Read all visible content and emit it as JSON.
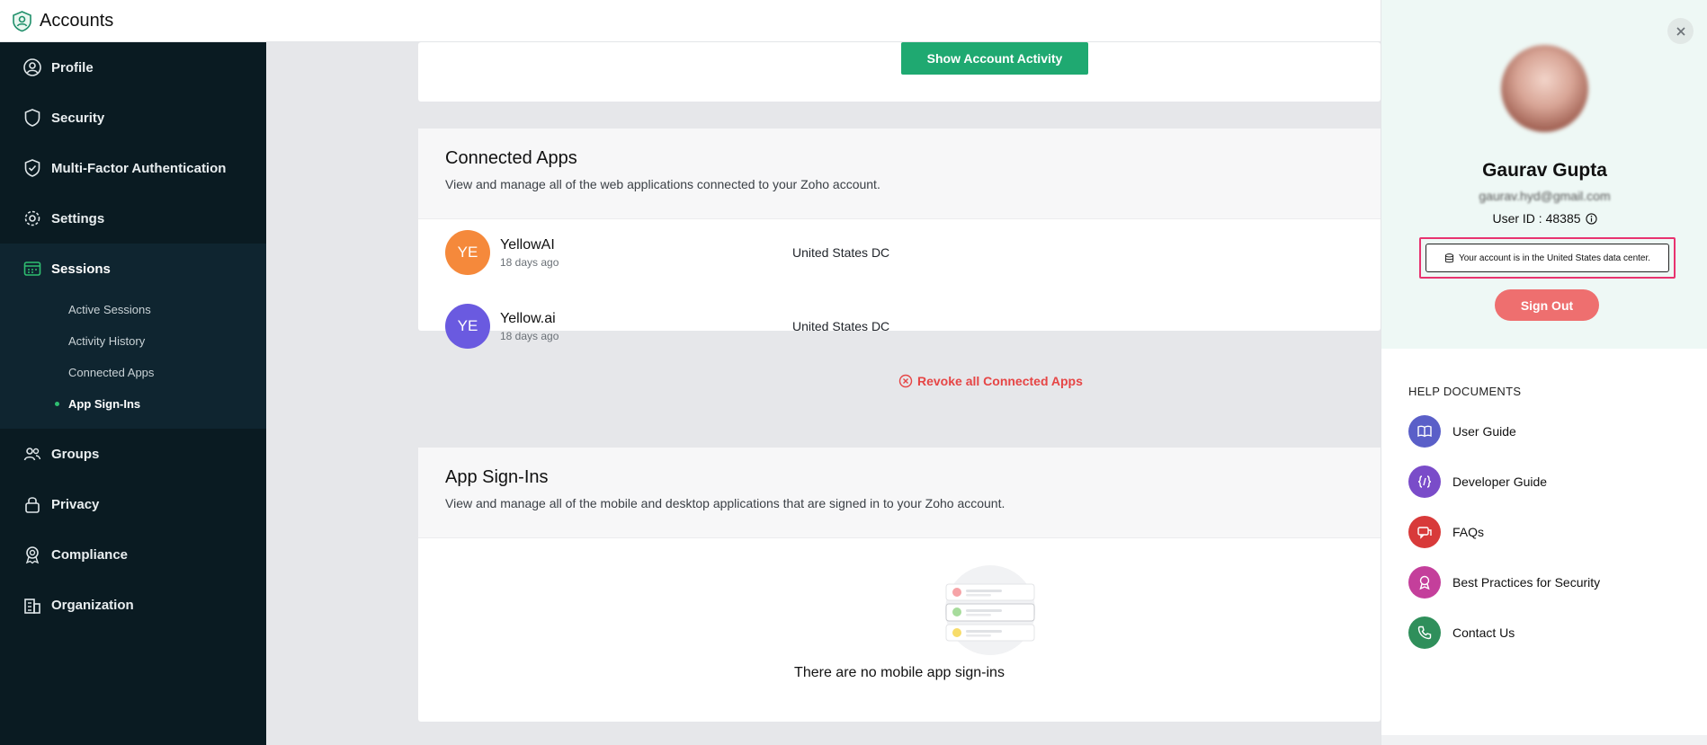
{
  "header": {
    "title": "Accounts"
  },
  "sidebar": {
    "items": [
      {
        "label": "Profile",
        "icon": "user-circle-icon"
      },
      {
        "label": "Security",
        "icon": "shield-icon"
      },
      {
        "label": "Multi-Factor Authentication",
        "icon": "shield-check-icon"
      },
      {
        "label": "Settings",
        "icon": "gear-icon"
      },
      {
        "label": "Sessions",
        "icon": "sessions-icon",
        "active": true
      },
      {
        "label": "Groups",
        "icon": "users-icon"
      },
      {
        "label": "Privacy",
        "icon": "lock-icon"
      },
      {
        "label": "Compliance",
        "icon": "badge-icon"
      },
      {
        "label": "Organization",
        "icon": "building-icon"
      }
    ],
    "sessions_sub": [
      {
        "label": "Active Sessions"
      },
      {
        "label": "Activity History"
      },
      {
        "label": "Connected Apps"
      },
      {
        "label": "App Sign-Ins",
        "current": true
      }
    ]
  },
  "main": {
    "show_activity_label": "Show Account Activity",
    "connected_apps": {
      "title": "Connected Apps",
      "description": "View and manage all of the web applications connected to your Zoho account.",
      "apps": [
        {
          "initials": "YE",
          "name": "YellowAI",
          "time": "18 days ago",
          "dc": "United States DC",
          "color": "#f5893b"
        },
        {
          "initials": "YE",
          "name": "Yellow.ai",
          "time": "18 days ago",
          "dc": "United States DC",
          "color": "#6a5ae0"
        }
      ],
      "revoke_label": "Revoke all Connected Apps"
    },
    "app_signins": {
      "title": "App Sign-Ins",
      "description": "View and manage all of the mobile and desktop applications that are signed in to your Zoho account.",
      "empty_text": "There are no mobile app sign-ins"
    }
  },
  "panel": {
    "user_name": "Gaurav Gupta",
    "user_email": "gaurav.hyd@gmail.com",
    "user_id": "User ID : 48385",
    "data_center_text": "Your account is in the United States data center.",
    "sign_out_label": "Sign Out",
    "help_title": "HELP DOCUMENTS",
    "help_items": [
      {
        "label": "User Guide",
        "icon": "book-icon",
        "color": "#5a5fc8"
      },
      {
        "label": "Developer Guide",
        "icon": "code-icon",
        "color": "#7a4cc9"
      },
      {
        "label": "FAQs",
        "icon": "chat-icon",
        "color": "#d83a3a"
      },
      {
        "label": "Best Practices for Security",
        "icon": "award-icon",
        "color": "#c43f9b"
      },
      {
        "label": "Contact Us",
        "icon": "phone-icon",
        "color": "#2f8f5b"
      }
    ]
  },
  "colors": {
    "accent_green": "#1fa971",
    "sidebar_bg": "#0a1b22",
    "danger": "#e64545",
    "highlight": "#e8336f"
  }
}
